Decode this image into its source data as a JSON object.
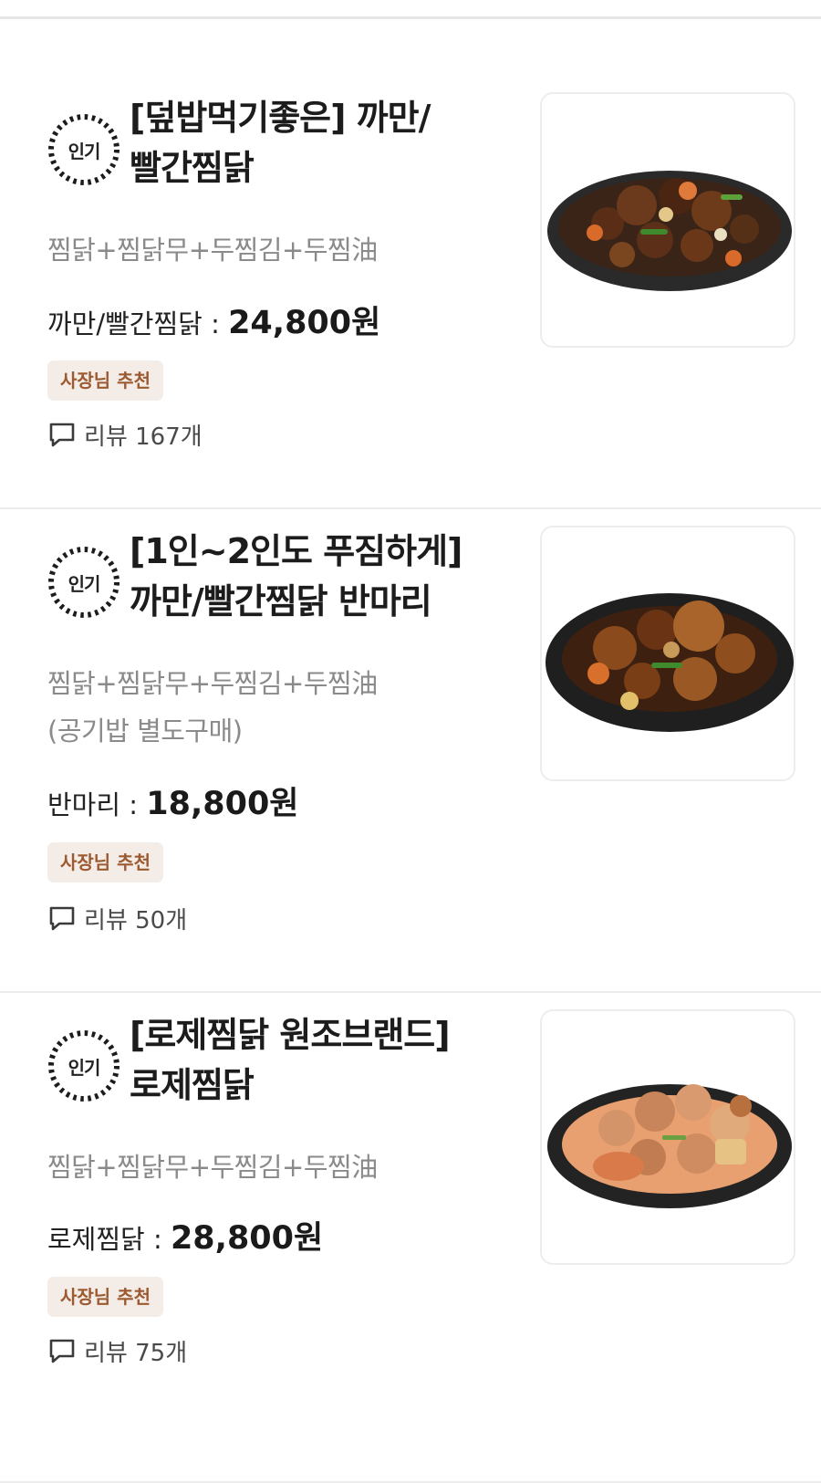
{
  "menu_items": [
    {
      "badge": "인기",
      "title_line1": "[덮밥먹기좋은] 까만/",
      "title_line2": "빨간찜닭",
      "description_line1": "찜닭+찜닭무+두찜김+두찜油",
      "description_line2": "",
      "price_label": "까만/빨간찜닭 : ",
      "price_value": "24,800원",
      "tag": "사장님 추천",
      "review": "리뷰 167개",
      "image_icon": "dark-braised-chicken-dish"
    },
    {
      "badge": "인기",
      "title_line1": "[1인~2인도 푸짐하게]",
      "title_line2": "까만/빨간찜닭 반마리",
      "description_line1": "찜닭+찜닭무+두찜김+두찜油",
      "description_line2": "(공기밥 별도구매)",
      "price_label": "반마리 : ",
      "price_value": "18,800원",
      "tag": "사장님 추천",
      "review": "리뷰 50개",
      "image_icon": "half-braised-chicken-dish"
    },
    {
      "badge": "인기",
      "title_line1": "[로제찜닭 원조브랜드]",
      "title_line2": "로제찜닭",
      "description_line1": "찜닭+찜닭무+두찜김+두찜油",
      "description_line2": "",
      "price_label": "로제찜닭 : ",
      "price_value": "28,800원",
      "tag": "사장님 추천",
      "review": "리뷰 75개",
      "image_icon": "rose-braised-chicken-dish"
    }
  ],
  "colors": {
    "tag_background": "#f4ece6",
    "tag_text": "#9c5a30",
    "description_text": "#8a8a8a",
    "divider": "#ececec"
  }
}
